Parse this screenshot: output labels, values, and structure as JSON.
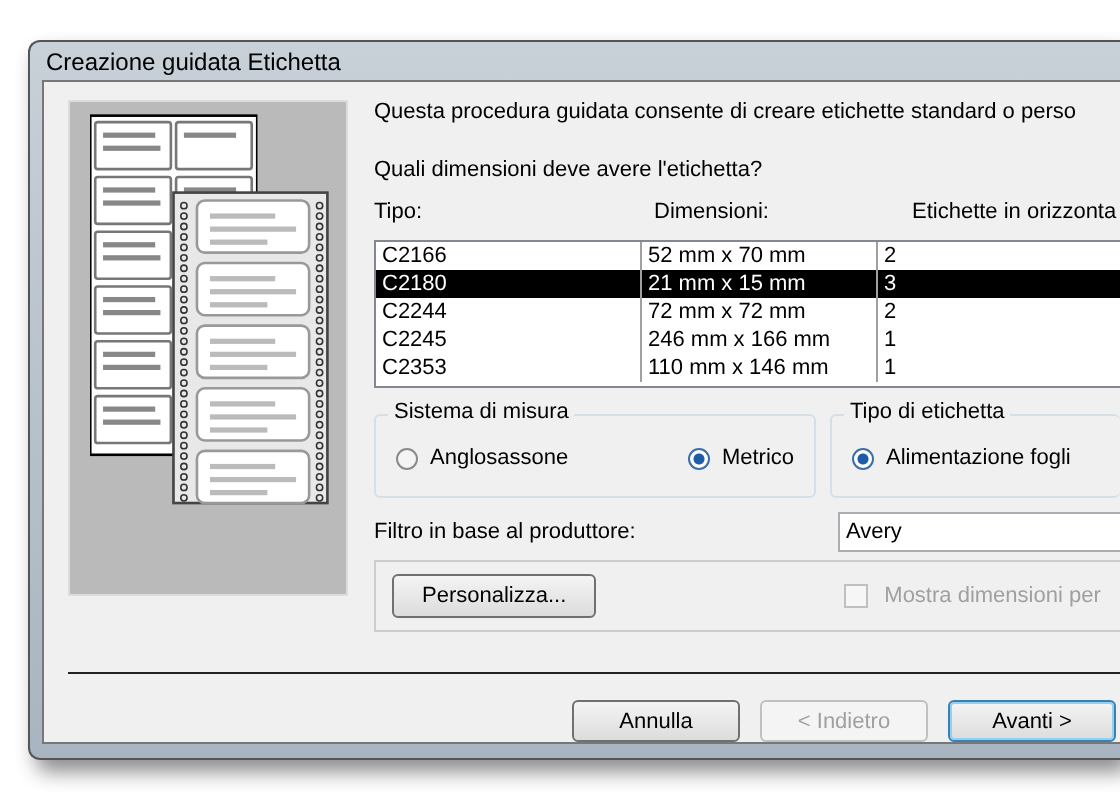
{
  "window": {
    "title": "Creazione guidata Etichetta"
  },
  "intro": "Questa procedura guidata consente di creare etichette standard o perso",
  "question": "Quali dimensioni deve avere l'etichetta?",
  "table": {
    "columns": [
      "Tipo:",
      "Dimensioni:",
      "Etichette in orizzonta"
    ],
    "rows": [
      {
        "cells": [
          "C2166",
          "52 mm x 70 mm",
          "2"
        ],
        "selected": false
      },
      {
        "cells": [
          "C2180",
          "21 mm x 15 mm",
          "3"
        ],
        "selected": true
      },
      {
        "cells": [
          "C2244",
          "72 mm x 72 mm",
          "2"
        ],
        "selected": false
      },
      {
        "cells": [
          "C2245",
          "246 mm x 166 mm",
          "1"
        ],
        "selected": false
      },
      {
        "cells": [
          "C2353",
          "110 mm x 146 mm",
          "1"
        ],
        "selected": false
      }
    ]
  },
  "measure_group": {
    "title": "Sistema di misura",
    "options": [
      {
        "label": "Anglosassone",
        "selected": false
      },
      {
        "label": "Metrico",
        "selected": true
      }
    ]
  },
  "label_type_group": {
    "title": "Tipo di etichetta",
    "options": [
      {
        "label": "Alimentazione fogli",
        "selected": true
      }
    ]
  },
  "filter": {
    "label": "Filtro in base al produttore:",
    "value": "Avery"
  },
  "customize_button": "Personalizza...",
  "show_dimensions": {
    "label": "Mostra dimensioni per",
    "checked": false,
    "disabled": true
  },
  "buttons": [
    {
      "label": "Annulla",
      "disabled": false,
      "default": false
    },
    {
      "label": "< Indietro",
      "disabled": true,
      "default": false
    },
    {
      "label": "Avanti >",
      "disabled": false,
      "default": true
    }
  ]
}
